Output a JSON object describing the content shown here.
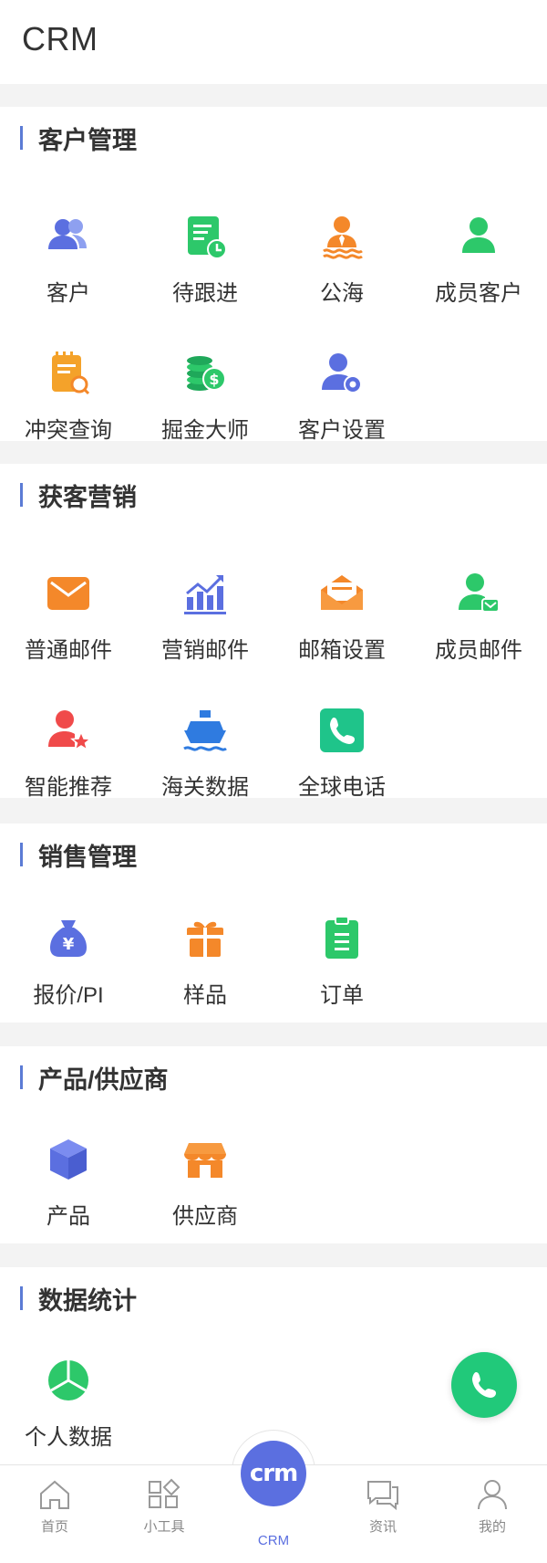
{
  "header": {
    "title": "CRM"
  },
  "sections": [
    {
      "title": "客户管理",
      "items": [
        {
          "label": "客户",
          "icon": "customers-icon"
        },
        {
          "label": "待跟进",
          "icon": "follow-up-icon"
        },
        {
          "label": "公海",
          "icon": "public-sea-icon"
        },
        {
          "label": "成员客户",
          "icon": "member-customer-icon"
        },
        {
          "label": "冲突查询",
          "icon": "conflict-search-icon"
        },
        {
          "label": "掘金大师",
          "icon": "coins-icon"
        },
        {
          "label": "客户设置",
          "icon": "customer-settings-icon"
        }
      ]
    },
    {
      "title": "获客营销",
      "items": [
        {
          "label": "普通邮件",
          "icon": "mail-icon"
        },
        {
          "label": "营销邮件",
          "icon": "marketing-chart-icon"
        },
        {
          "label": "邮箱设置",
          "icon": "mailbox-settings-icon"
        },
        {
          "label": "成员邮件",
          "icon": "member-mail-icon"
        },
        {
          "label": "智能推荐",
          "icon": "smart-recommend-icon"
        },
        {
          "label": "海关数据",
          "icon": "ship-icon"
        },
        {
          "label": "全球电话",
          "icon": "global-phone-icon"
        }
      ]
    },
    {
      "title": "销售管理",
      "items": [
        {
          "label": "报价/PI",
          "icon": "money-bag-icon"
        },
        {
          "label": "样品",
          "icon": "gift-icon"
        },
        {
          "label": "订单",
          "icon": "clipboard-icon"
        }
      ]
    },
    {
      "title": "产品/供应商",
      "items": [
        {
          "label": "产品",
          "icon": "cube-icon"
        },
        {
          "label": "供应商",
          "icon": "store-icon"
        }
      ]
    },
    {
      "title": "数据统计",
      "items": [
        {
          "label": "个人数据",
          "icon": "pie-chart-icon"
        }
      ]
    }
  ],
  "tabbar": [
    {
      "label": "首页",
      "icon": "home-icon"
    },
    {
      "label": "小工具",
      "icon": "tools-icon"
    },
    {
      "label": "CRM",
      "icon": "crm-icon",
      "badge": "crm"
    },
    {
      "label": "资讯",
      "icon": "chat-icon"
    },
    {
      "label": "我的",
      "icon": "profile-icon"
    }
  ],
  "colors": {
    "accent": "#5b6fe0",
    "green": "#21c97a",
    "orange": "#f4882a",
    "section_bar": "#5b7bd5"
  }
}
